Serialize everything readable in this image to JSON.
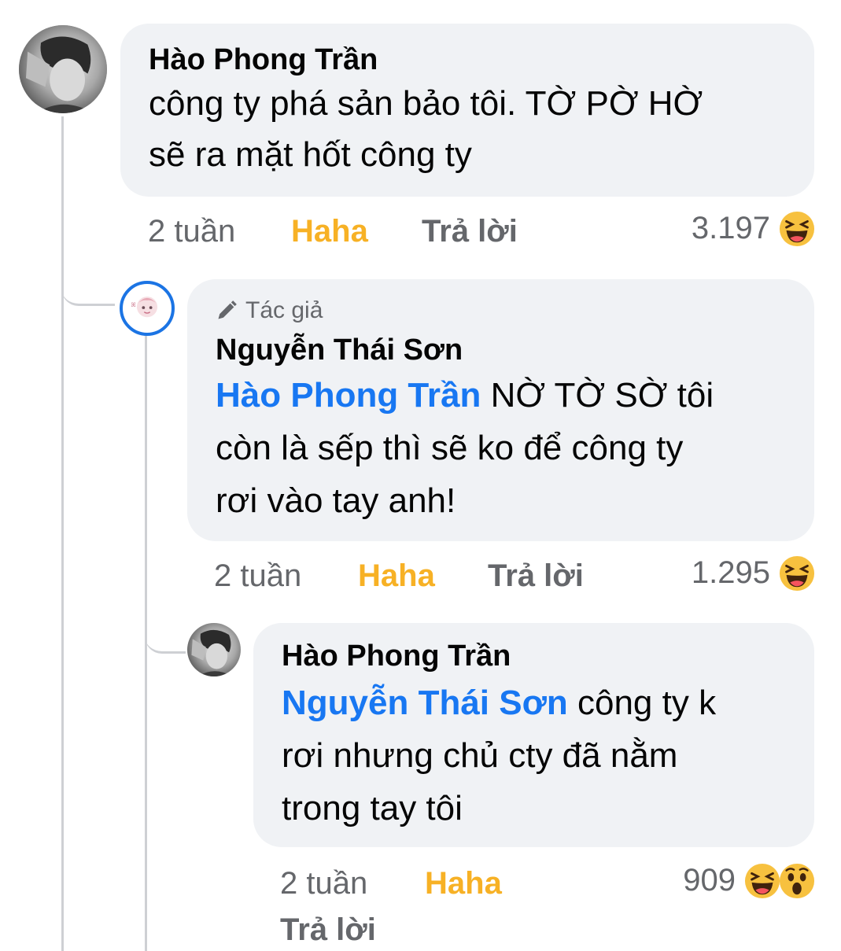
{
  "comments": [
    {
      "author": "Hào Phong Trần",
      "text_lines": [
        "công ty phá sản bảo tôi. TỜ PỜ HỜ",
        "sẽ ra mặt hốt công ty"
      ],
      "time": "2 tuần",
      "reaction_label": "Haha",
      "reply_label": "Trả lời",
      "reaction_count": "3.197",
      "reactions": [
        "haha-emoji"
      ]
    },
    {
      "author_tag": "Tác giả",
      "author": "Nguyễn Thái Sơn",
      "mention": "Hào Phong Trần",
      "text_first": " NỜ TỜ SỜ tôi",
      "text_lines": [
        "còn là sếp thì sẽ ko để công ty",
        "rơi vào tay anh!"
      ],
      "time": "2 tuần",
      "reaction_label": "Haha",
      "reply_label": "Trả lời",
      "reaction_count": "1.295",
      "reactions": [
        "haha-emoji"
      ]
    },
    {
      "author": "Hào Phong Trần",
      "mention": "Nguyễn Thái Sơn",
      "text_first": " công ty k",
      "text_lines": [
        "rơi nhưng chủ cty đã nằm",
        "trong tay tôi"
      ],
      "time": "2 tuần",
      "reaction_label": "Haha",
      "reply_label": "Trả lời",
      "reaction_count": "909",
      "reactions": [
        "haha-emoji",
        "wow-emoji"
      ]
    }
  ],
  "colors": {
    "bubble": "#f0f2f5",
    "mention": "#1877f2",
    "haha": "#f7b125",
    "meta": "#65676b",
    "author_ring": "#1b74e4"
  }
}
